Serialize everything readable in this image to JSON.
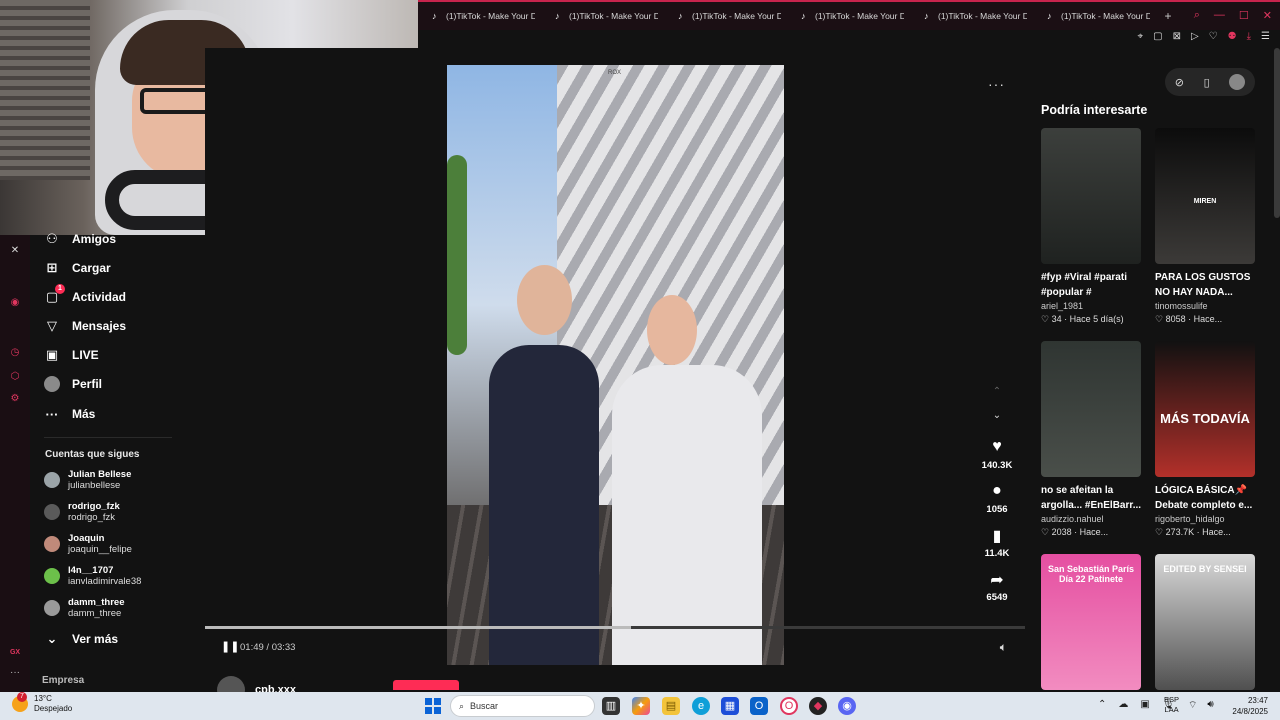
{
  "browser": {
    "tabs": [
      "(1)TikTok - Make Your D",
      "(1)TikTok - Make Your D",
      "(1)TikTok - Make Your D",
      "(1)TikTok - Make Your D",
      "(1)TikTok - Make Your D",
      "(1)TikTok - Make Your D"
    ],
    "new_tab": "+"
  },
  "sidebar": {
    "items": [
      {
        "label": "Amigos",
        "icon": "friends-icon",
        "glyph": "⚇"
      },
      {
        "label": "Cargar",
        "icon": "upload-icon",
        "glyph": "⊞"
      },
      {
        "label": "Actividad",
        "icon": "activity-icon",
        "glyph": "▢",
        "badge": "1"
      },
      {
        "label": "Mensajes",
        "icon": "messages-icon",
        "glyph": "▽"
      },
      {
        "label": "LIVE",
        "icon": "live-icon",
        "glyph": "▣"
      },
      {
        "label": "Perfil",
        "icon": "profile-avatar",
        "glyph": "●"
      },
      {
        "label": "Más",
        "icon": "more-icon",
        "glyph": "···"
      }
    ],
    "following_title": "Cuentas que sigues",
    "following": [
      {
        "name": "Julian Bellese",
        "handle": "julianbellese"
      },
      {
        "name": "rodrigo_fzk",
        "handle": "rodrigo_fzk"
      },
      {
        "name": "Joaquin",
        "handle": "joaquin__felipe"
      },
      {
        "name": "l4n__1707",
        "handle": "ianvladimirvale38"
      },
      {
        "name": "damm_three",
        "handle": "damm_three"
      }
    ],
    "see_more": "Ver más",
    "company": "Empresa"
  },
  "video": {
    "watermark": "ROX",
    "likes": "140.3K",
    "comments": "1056",
    "saves": "11.4K",
    "shares": "6549",
    "time": "01:49 / 03:33",
    "progress": 0.52,
    "author": "cpb.xxx"
  },
  "recommendations": {
    "title": "Podría interesarte",
    "cards": [
      {
        "caption": "#fyp #Viral #parati",
        "caption2": "#popular #",
        "author": "ariel_1981",
        "likes": "34",
        "when": "Hace 5 día(s)",
        "thumb_text": "",
        "bg": "linear-gradient(180deg,#3c3f3c,#1f2220)"
      },
      {
        "caption": "PARA LOS GUSTOS",
        "caption2": "NO HAY NADA...",
        "author": "tinomossulife",
        "likes": "8058",
        "when": "Hace...",
        "thumb_text": "MIREN",
        "bg": "linear-gradient(180deg,#0c0c0c,#3c3a38)"
      },
      {
        "caption": "no se afeitan la",
        "caption2": "argolla... #EnElBarr...",
        "author": "audizzio.nahuel",
        "likes": "2038",
        "when": "Hace...",
        "thumb_text": "",
        "bg": "linear-gradient(180deg,#2f3532,#4a4f4a)"
      },
      {
        "caption": "LÓGICA BÁSICA📌",
        "caption2": "Debate completo e...",
        "author": "rigoberto_hidalgo",
        "likes": "273.7K",
        "when": "Hace...",
        "thumb_text": "MÁS TODAVÍA",
        "bg": "linear-gradient(180deg,#111,#b3302a)"
      },
      {
        "caption": "",
        "caption2": "",
        "author": "",
        "likes": "",
        "when": "",
        "thumb_text": "San Sebastián París Día 22 Patinete",
        "bg": "linear-gradient(180deg,#e54fa1,#f28cc0)"
      },
      {
        "caption": "",
        "caption2": "",
        "author": "",
        "likes": "",
        "when": "",
        "thumb_text": "EDITED BY SENSEI",
        "bg": "linear-gradient(180deg,#d9d9d9,#505050)"
      }
    ]
  },
  "taskbar": {
    "temp": "13°C",
    "weather": "Despejado",
    "weather_badge": "7",
    "search_placeholder": "Buscar",
    "lang1": "ESP",
    "lang2": "LAA",
    "time": "23:47",
    "date": "24/8/2025"
  },
  "colors": {
    "accent": "#fe2c55",
    "opera_red": "#e0365f"
  }
}
